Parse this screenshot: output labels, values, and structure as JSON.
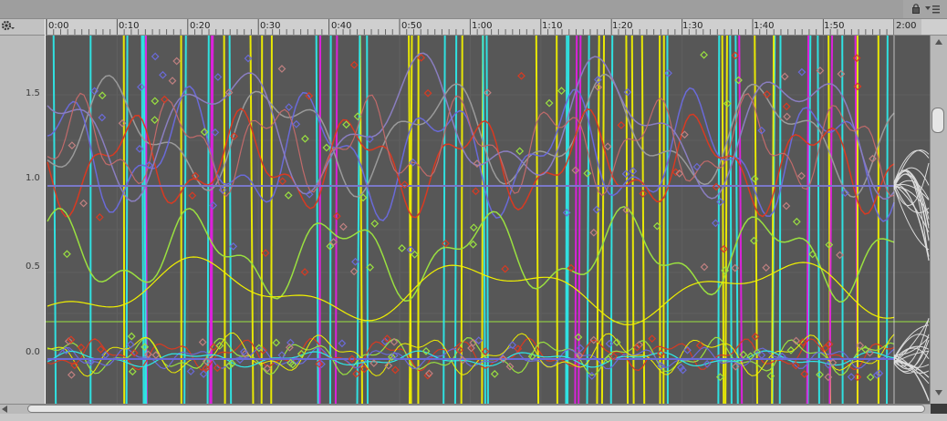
{
  "window": {
    "lock_icon": "lock-icon",
    "menu_icon": "menu-icon"
  },
  "timeline": {
    "ticks": [
      "0:00",
      "0:10",
      "0:20",
      "0:30",
      "0:40",
      "0:50",
      "1:00",
      "1:10",
      "1:20",
      "1:30",
      "1:40",
      "1:50"
    ],
    "end_label": "2:00",
    "settings_icon": "gear-icon"
  },
  "value_axis": {
    "labels": [
      "1.5",
      "1.0",
      "0.5",
      "0.0"
    ]
  },
  "colors": {
    "background": "#575757",
    "cyan": "#2ee8e8",
    "yellow": "#f0f000",
    "magenta": "#e020e0",
    "red": "#d83a22",
    "green": "#9ae040",
    "purple": "#6a6ad8",
    "gray": "#9a9a9a",
    "white": "#ffffff"
  },
  "status": {
    "text": ""
  }
}
